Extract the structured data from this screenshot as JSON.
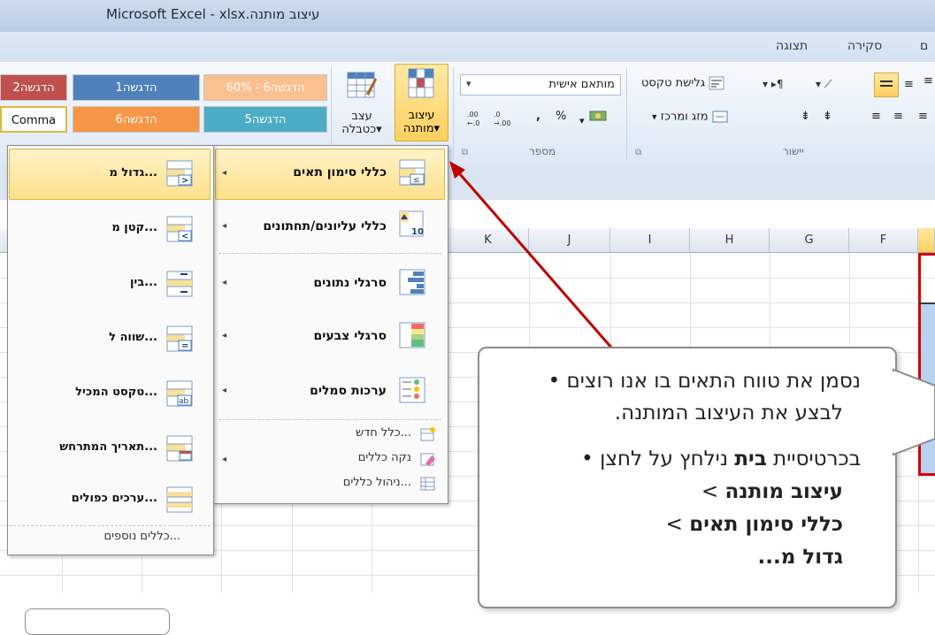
{
  "window": {
    "title": "Microsoft Excel - xlsx.עיצוב מותנה"
  },
  "tabs": [
    "תצוגה",
    "סקירה",
    "ם"
  ],
  "ribbon": {
    "styles": [
      {
        "label": "הדגשה2",
        "color": "#c0504d"
      },
      {
        "label": "הדגשה1",
        "color": "#4f81bd"
      },
      {
        "label": "60% - הדגשה6",
        "color": "#fac090"
      },
      {
        "label": "Comma",
        "color": "#ffffff"
      },
      {
        "label": "הדגשה6",
        "color": "#f79646"
      },
      {
        "label": "הדגשה5",
        "color": "#4bacc6"
      }
    ],
    "format_table_label": "עצב\nכטבלה",
    "format_table_line1": "עצב",
    "format_table_line2": "כטבלה",
    "cf_line1": "עיצוב",
    "cf_line2": "מותנה",
    "number_format_value": "מותאם אישית",
    "number_group_label": "מספר",
    "alignment_group_label": "יישור",
    "wrap_text_label": "גלישת טקסט",
    "merge_center_label": "מזג ומרכז",
    "percent": "%",
    "comma": ",",
    "inc_dec": ".00 ←.0",
    "dec_dec": ".00 →.0"
  },
  "columns": [
    "K",
    "J",
    "I",
    "H",
    "G",
    "F"
  ],
  "menu_main": {
    "items": [
      {
        "label": "כללי סימון תאים",
        "bold": true,
        "arrow": "◂"
      },
      {
        "label": "כללי עליונים/תחתונים",
        "bold": true,
        "arrow": "◂"
      },
      {
        "label": "סרגלי נתונים",
        "bold": true,
        "arrow": "◂"
      },
      {
        "label": "סרגלי צבעים",
        "bold": true,
        "arrow": "◂"
      },
      {
        "label": "ערכות סמלים",
        "bold": true,
        "arrow": "◂"
      }
    ],
    "small_items": [
      {
        "label": "כלל חדש..."
      },
      {
        "label": "נקה כללים"
      },
      {
        "label": "ניהול כללים..."
      }
    ],
    "small_arrow": "◂"
  },
  "menu_sub": {
    "items": [
      {
        "label": "גדול מ..."
      },
      {
        "label": "קטן מ..."
      },
      {
        "label": "בין..."
      },
      {
        "label": "שווה ל..."
      },
      {
        "label": "טקסט המכיל..."
      },
      {
        "label": "תאריך המתרחש..."
      },
      {
        "label": "ערכים כפולים..."
      }
    ],
    "more": "כללים נוספים..."
  },
  "callout": {
    "bullet": "•",
    "line1": "נסמן את טווח התאים בו אנו רוצים",
    "line2": "לבצע את העיצוב המותנה.",
    "line3_pre": "בכרטיסיית ",
    "line3_bold": "בית",
    "line3_post": " נילחץ על לחצן",
    "line4": "עיצוב מותנה",
    "line5": "כללי סימון תאים",
    "line6": "גדול מ...",
    "sep": ">"
  },
  "colors": {
    "highlight": "#ffd966",
    "arrow": "#c00000",
    "selection": "#d50000"
  }
}
